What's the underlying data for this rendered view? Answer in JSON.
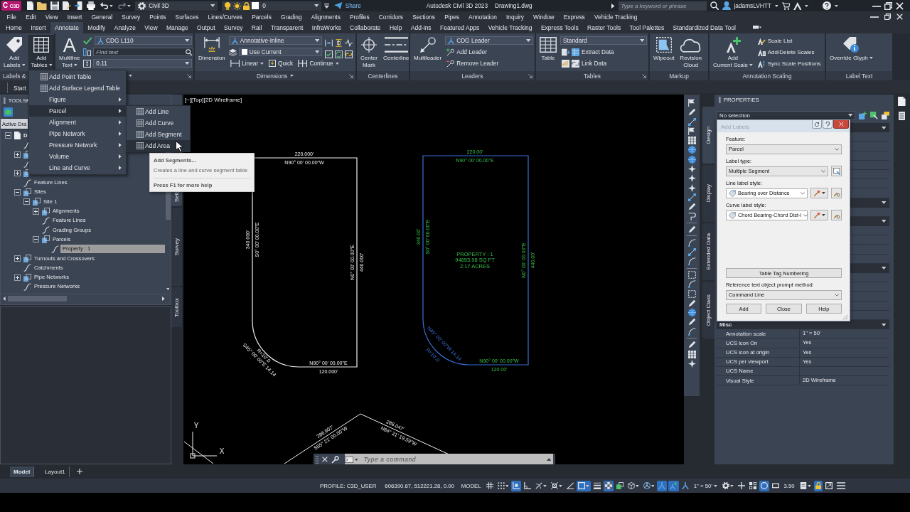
{
  "title_bar": {
    "badge_letter": "C",
    "badge_label": "C3D",
    "workspace": "Civil 3D",
    "layer": "0",
    "share": "Share",
    "app_title": "Autodesk Civil 3D 2023",
    "file_name": "Drawing1.dwg",
    "search": {
      "placeholder": "Type a keyword or phrase"
    },
    "user": "jadamsLVHTT"
  },
  "menu_bar": [
    "File",
    "Edit",
    "View",
    "Insert",
    "General",
    "Survey",
    "Points",
    "Surfaces",
    "Lines/Curves",
    "Parcels",
    "Grading",
    "Alignments",
    "Profiles",
    "Corridors",
    "Sections",
    "Pipes",
    "Annotation",
    "Inquiry",
    "Window",
    "Express",
    "Vehicle Tracking"
  ],
  "ribbon_tabs": [
    {
      "label": "Home",
      "selected": false
    },
    {
      "label": "Insert",
      "selected": false
    },
    {
      "label": "Annotate",
      "selected": true
    },
    {
      "label": "Modify",
      "selected": false
    },
    {
      "label": "Analyze",
      "selected": false
    },
    {
      "label": "View",
      "selected": false
    },
    {
      "label": "Manage",
      "selected": false
    },
    {
      "label": "Output",
      "selected": false
    },
    {
      "label": "Survey",
      "selected": false
    },
    {
      "label": "Rail",
      "selected": false
    },
    {
      "label": "Transparent",
      "selected": false
    },
    {
      "label": "InfraWorks",
      "selected": false
    },
    {
      "label": "Collaborate",
      "selected": false
    },
    {
      "label": "Help",
      "selected": false
    },
    {
      "label": "Add-ins",
      "selected": false
    },
    {
      "label": "Featured Apps",
      "selected": false
    },
    {
      "label": "Vehicle Tracking",
      "selected": false
    },
    {
      "label": "Express Tools",
      "selected": false
    },
    {
      "label": "Raster Tools",
      "selected": false
    },
    {
      "label": "Tool Palettes",
      "selected": false
    },
    {
      "label": "Standardized Data Tool",
      "selected": false
    }
  ],
  "ribbon_panels": [
    {
      "label": "Labels &",
      "has_menu": false,
      "launcher": false,
      "items": [
        {
          "kind": "large",
          "label": "Add\nLabels",
          "dropdown": true,
          "pressed": false
        },
        {
          "kind": "large",
          "label": "Add\nTables",
          "dropdown": true,
          "pressed": true
        }
      ]
    },
    {
      "has_menu": true,
      "launcher": true,
      "items": [
        {
          "kind": "large",
          "label": "Multiline\nText",
          "glyph": "A",
          "dropdown": true,
          "pressed": false
        },
        {
          "kind": "stack",
          "rows": [
            {
              "kind": "combo",
              "value": "CDG L110"
            },
            {
              "kind": "input",
              "placeholder": "Find text"
            },
            {
              "kind": "combo",
              "value": "0.11"
            }
          ]
        }
      ]
    },
    {
      "label": "Dimensions",
      "has_menu": true,
      "launcher": true,
      "items": [
        {
          "kind": "large",
          "label": "Dimension",
          "dropdown": false,
          "pressed": false
        },
        {
          "kind": "stack",
          "rows": [
            {
              "kind": "combo",
              "value": "Annotative-Inline"
            },
            {
              "kind": "combo",
              "value": "Use Current"
            },
            {
              "kind": "buttons",
              "buttons": [
                {
                  "label": "Linear",
                  "dropdown": true
                },
                {
                  "label": "Quick",
                  "dropdown": false
                },
                {
                  "label": "Continue",
                  "dropdown": true
                }
              ]
            }
          ]
        },
        {
          "kind": "tools"
        }
      ]
    },
    {
      "label": "Centerlines",
      "has_menu": false,
      "launcher": false,
      "items": [
        {
          "kind": "large",
          "label": "Center\nMark",
          "dropdown": false,
          "pressed": false
        },
        {
          "kind": "large",
          "label": "Centerline",
          "dropdown": false,
          "pressed": false
        }
      ]
    },
    {
      "label": "Leaders",
      "has_menu": false,
      "launcher": true,
      "items": [
        {
          "kind": "large",
          "label": "Multileader",
          "dropdown": false,
          "pressed": false
        },
        {
          "kind": "stack",
          "rows": [
            {
              "kind": "combo",
              "value": "CDG Leader"
            },
            {
              "kind": "small",
              "label": "Add Leader"
            },
            {
              "kind": "small",
              "label": "Remove Leader"
            }
          ]
        }
      ]
    },
    {
      "label": "Tables",
      "has_menu": false,
      "launcher": true,
      "items": [
        {
          "kind": "large",
          "label": "Table",
          "dropdown": false,
          "pressed": false
        },
        {
          "kind": "stack",
          "rows": [
            {
              "kind": "combo",
              "value": "Standard"
            },
            {
              "kind": "small",
              "label": "Extract Data"
            },
            {
              "kind": "small",
              "label": "Link Data"
            }
          ]
        }
      ]
    },
    {
      "label": "Markup",
      "has_menu": false,
      "launcher": false,
      "items": [
        {
          "kind": "large",
          "label": "Wipeout",
          "dropdown": false,
          "pressed": false
        },
        {
          "kind": "large",
          "label": "Revision\nCloud",
          "dropdown": false,
          "pressed": false
        }
      ]
    },
    {
      "label": "Annotation Scaling",
      "has_menu": false,
      "launcher": false,
      "items": [
        {
          "kind": "large",
          "label": "Add\nCurrent Scale",
          "dropdown": true,
          "pressed": false
        },
        {
          "kind": "stack",
          "rows": [
            {
              "kind": "small",
              "label": "Scale List"
            },
            {
              "kind": "small",
              "label": "Add/Delete Scales"
            },
            {
              "kind": "small",
              "label": "Sync Scale Positions"
            }
          ]
        }
      ]
    },
    {
      "label": "Label Text",
      "has_menu": false,
      "launcher": false,
      "items": [
        {
          "kind": "large",
          "label": "Override Glyph",
          "dropdown": true,
          "pressed": false
        }
      ]
    }
  ],
  "file_tab": {
    "label": "Start"
  },
  "toolspace": {
    "title": "TOOLSP",
    "tabs": [
      {
        "label": "Active Dra",
        "selected": true
      }
    ],
    "tree": [
      {
        "label": "D",
        "expanded": true,
        "selected": false,
        "children": [
          {
            "selected": false
          },
          {
            "expanded": false,
            "selected": false
          },
          {
            "selected": false
          },
          {
            "expanded": false,
            "selected": false
          },
          {
            "label": "Feature Lines",
            "selected": false
          },
          {
            "label": "Sites",
            "expanded": true,
            "selected": false,
            "children": [
              {
                "label": "Site 1",
                "expanded": true,
                "selected": false,
                "children": [
                  {
                    "label": "Alignments",
                    "expanded": false,
                    "selected": false
                  },
                  {
                    "label": "Feature Lines",
                    "selected": false
                  },
                  {
                    "label": "Grading Groups",
                    "selected": false
                  },
                  {
                    "label": "Parcels",
                    "expanded": true,
                    "selected": false,
                    "children": [
                      {
                        "label": "Property : 1",
                        "selected": true
                      }
                    ]
                  }
                ]
              }
            ]
          },
          {
            "label": "Turnouts and Crossovers",
            "expanded": false,
            "selected": false
          },
          {
            "label": "Catchments",
            "selected": false
          },
          {
            "label": "Pipe Networks",
            "expanded": false,
            "selected": false
          },
          {
            "label": "Pressure Networks",
            "selected": false
          }
        ]
      }
    ]
  },
  "toolspace_side_tabs": [
    {
      "label": "Sett",
      "selected": true
    },
    {
      "label": "Survey",
      "selected": false
    },
    {
      "label": "Toolbox",
      "selected": false
    }
  ],
  "tables_menu": [
    {
      "label": "Add Point Table",
      "kind": "command",
      "selected": false
    },
    {
      "label": "Add Surface Legend Table",
      "kind": "command",
      "selected": false
    },
    {
      "label": "Figure",
      "kind": "submenu",
      "selected": false
    },
    {
      "label": "Parcel",
      "kind": "submenu",
      "selected": true
    },
    {
      "label": "Alignment",
      "kind": "submenu",
      "selected": false
    },
    {
      "label": "Pipe Network",
      "kind": "submenu",
      "selected": false
    },
    {
      "label": "Pressure Network",
      "kind": "submenu",
      "selected": false
    },
    {
      "label": "Volume",
      "kind": "submenu",
      "selected": false
    },
    {
      "label": "Line and Curve",
      "kind": "submenu",
      "selected": false
    }
  ],
  "tables_submenu": [
    {
      "label": "Add Line",
      "selected": false
    },
    {
      "label": "Add Curve",
      "selected": false
    },
    {
      "label": "Add Segment",
      "selected": false
    },
    {
      "label": "Add Area",
      "selected": true
    }
  ],
  "tooltip": {
    "title": "Add Segments...",
    "description": "Creates a line and curve segment table",
    "help": "Press F1 for more help"
  },
  "viewport": {
    "label": "[−][Top][2D Wireframe]",
    "parcels": [
      {
        "color": "#f0f0f0",
        "segment_labels": [
          "220.000'",
          "N90° 00' 00.00\"W",
          "340.000'",
          "S0° 00' 00.00\"E",
          "N0° 00' 00.00\"E",
          "440.000'",
          "N90° 00' 00.00\"E",
          "120.000'"
        ],
        "curve_labels": [
          "R=10'.0",
          "S45° 00' 00\"E 14.14"
        ]
      },
      {
        "color": "#3a6fd8",
        "segment_labels": [
          "220.00'",
          "N90° 00' 00.00\"E",
          "340.00'",
          "S0° 00' 00.00\"E",
          "N0° 00' 00.00\"E",
          "440.00'",
          "N90° 00' 00.00\"W",
          "120.00'"
        ],
        "curve_labels": [
          "R=10'.0",
          "N45° 00' 00\"W 14.14"
        ],
        "area_label": [
          "PROPERTY : 1",
          "94653.98 SQ FT",
          "2.17 ACRES"
        ]
      }
    ],
    "boundary_lines": [
      {
        "labels": [
          "286.907'",
          "S55° 21' 00.00\"W"
        ]
      },
      {
        "labels": [
          "286.047'",
          "N84° 21' 19.59\"W"
        ]
      }
    ],
    "ucs_icon": {
      "x_label": "X",
      "y_label": "Y"
    },
    "command_line": {
      "placeholder": "Type a command"
    }
  },
  "palette_tabs": [
    {
      "label": "Design",
      "selected": true
    },
    {
      "label": "Display",
      "selected": false
    },
    {
      "label": "Extended Data",
      "selected": false
    },
    {
      "label": "Object Class",
      "selected": false
    }
  ],
  "properties": {
    "title": "PROPERTIES",
    "selection": "No selection",
    "sections": [
      {
        "expanded": true,
        "rows": [
          {},
          {},
          {},
          {},
          {},
          {},
          {}
        ]
      },
      {
        "expanded": true,
        "rows": [
          {}
        ]
      },
      {
        "expanded": true,
        "rows": [
          {},
          {},
          {},
          {}
        ]
      },
      {
        "expanded": true,
        "rows": [
          {},
          {},
          {},
          {},
          {}
        ]
      },
      {
        "title": "Misc",
        "expanded": true,
        "rows": [
          {
            "label": "Annotation scale",
            "value": "1\" = 50'"
          },
          {
            "label": "UCS icon On",
            "value": "Yes"
          },
          {
            "label": "UCS icon at origin",
            "value": "Yes"
          },
          {
            "label": "UCS per viewport",
            "value": "Yes"
          },
          {
            "label": "UCS Name"
          },
          {
            "label": "Visual Style",
            "value": "2D Wireframe"
          }
        ]
      }
    ]
  },
  "add_labels_dialog": {
    "title": "Add Labels",
    "feature": {
      "label": "Feature:",
      "value": "Parcel"
    },
    "label_type": {
      "label": "Label type:",
      "value": "Multiple Segment"
    },
    "line_label_style": {
      "label": "Line label style:",
      "value": "Bearing over Distance"
    },
    "curve_label_style": {
      "label": "Curve label style:",
      "value": "Chord Bearing-Chord Dist-l"
    },
    "table_tag_button": "Table Tag Numbering",
    "reference_prompt": {
      "label": "Reference text object prompt method:",
      "value": "Command Line"
    },
    "buttons": [
      "Add",
      "Close",
      "Help"
    ]
  },
  "layout_tabs": [
    {
      "label": "Model",
      "selected": true
    },
    {
      "label": "Layout1",
      "selected": false
    }
  ],
  "status_bar": {
    "profile": "PROFILE: C3D_USER",
    "coordinates": "606390.67, 512221.28, 0.00",
    "space": "MODEL",
    "toggles_a": [
      {
        "on": false
      },
      {
        "on": false
      },
      {
        "on": true
      },
      {
        "on": false
      },
      {
        "on": false
      },
      {
        "on": false
      },
      {
        "on": false
      },
      {
        "on": true
      },
      {
        "on": false
      },
      {
        "on": true
      },
      {
        "on": false
      },
      {
        "on": false
      },
      {
        "on": false
      },
      {
        "on": true
      },
      {
        "on": true
      },
      {
        "on": false
      }
    ],
    "scale": "1\" = 50'",
    "toggles_b": [
      {
        "on": false
      },
      {
        "on": false
      },
      {
        "on": false
      },
      {
        "on": true
      },
      {
        "on": false
      }
    ],
    "annotation_value": "3.50",
    "toggles_c": [
      {
        "on": false
      },
      {
        "on": true
      },
      {
        "on": false
      },
      {
        "on": false
      }
    ]
  }
}
